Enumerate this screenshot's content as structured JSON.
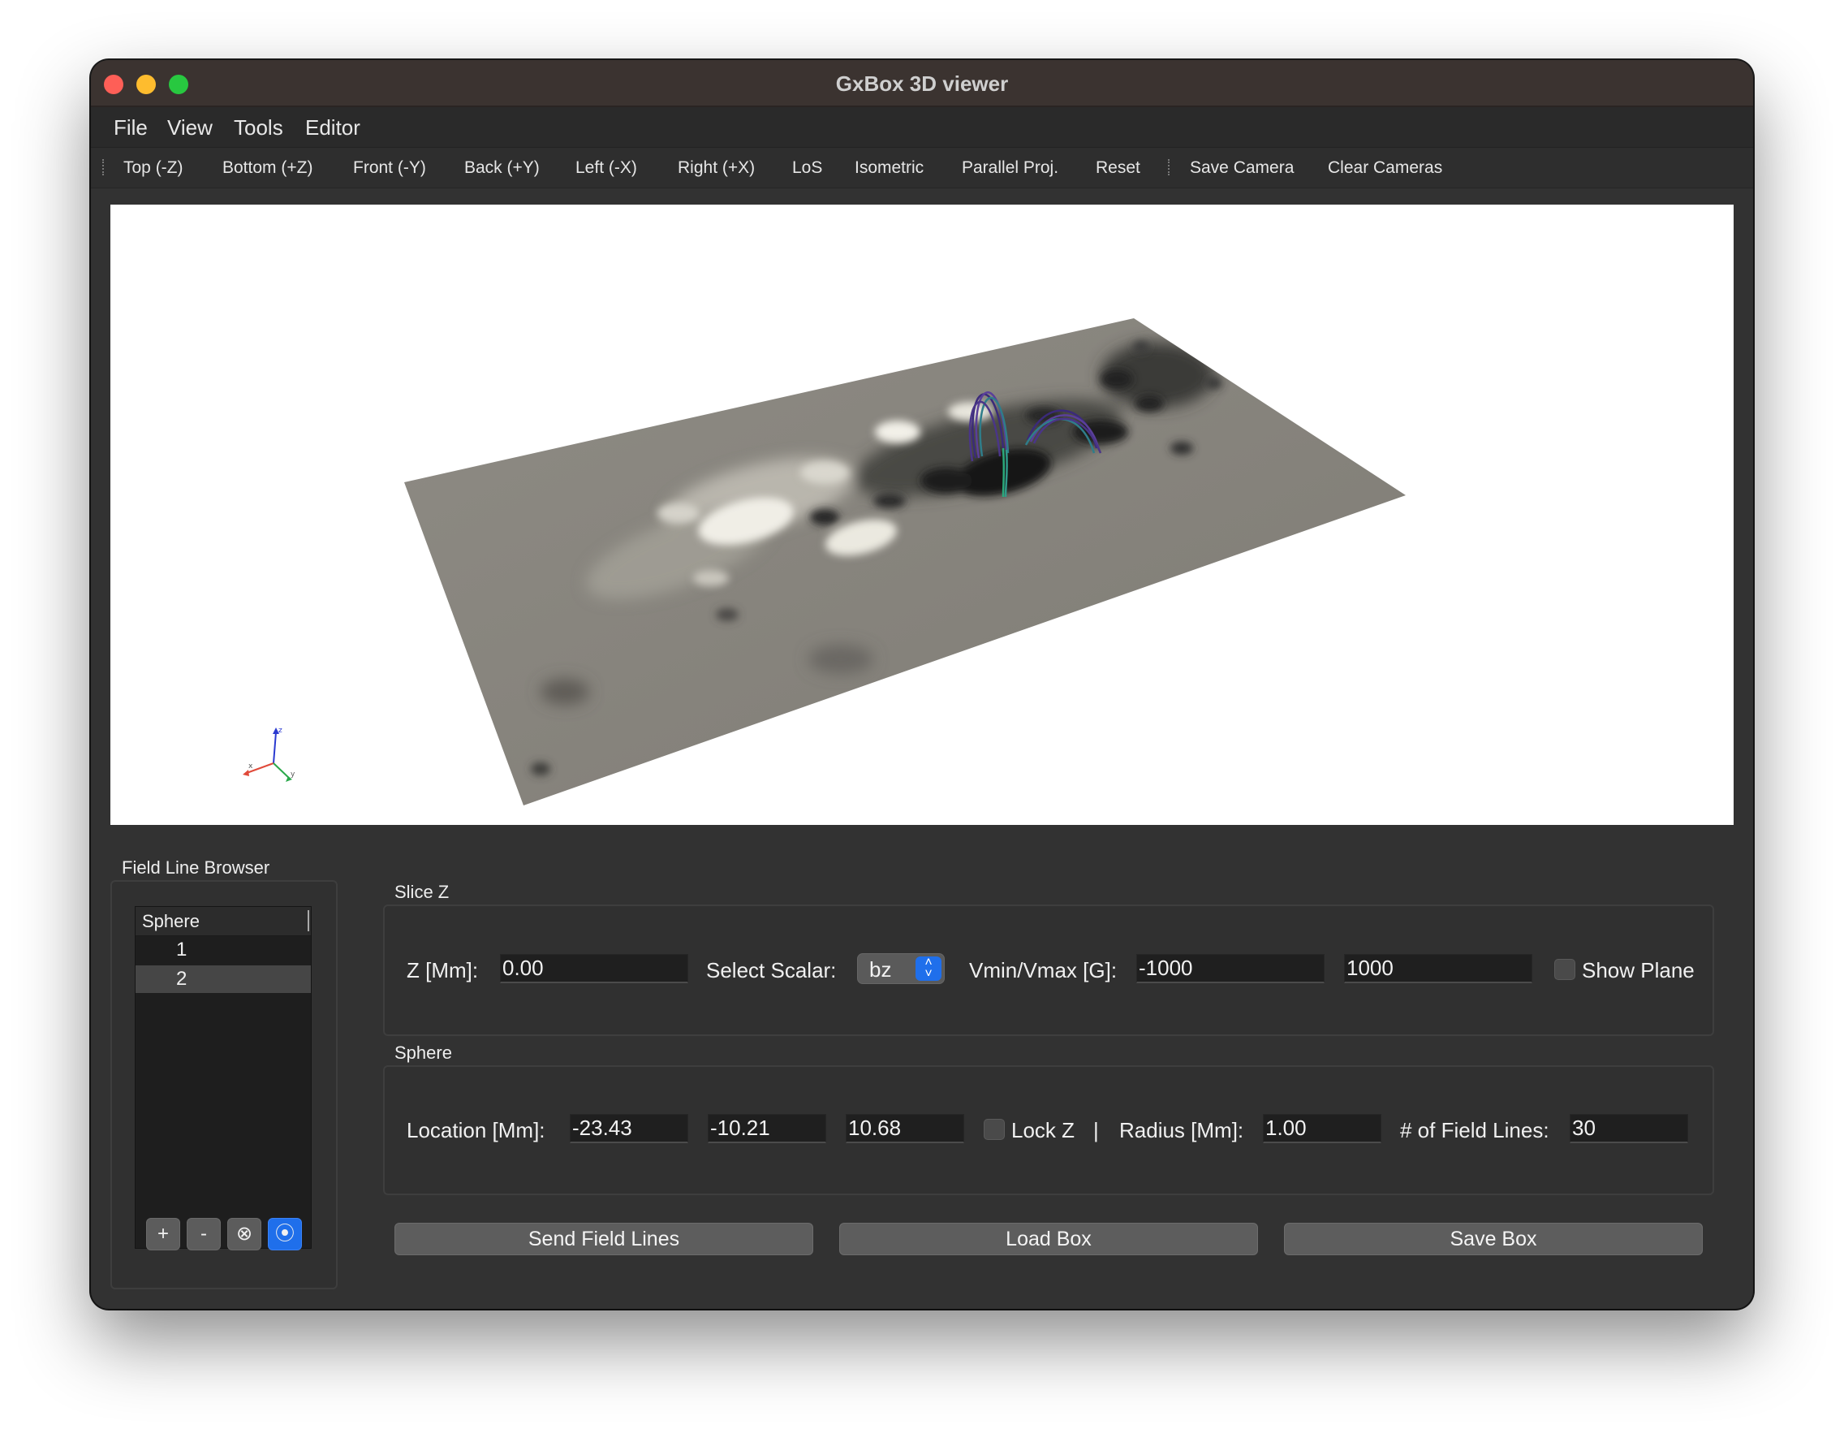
{
  "window": {
    "title": "GxBox 3D viewer"
  },
  "menu": [
    "File",
    "View",
    "Tools",
    "Editor"
  ],
  "toolbar": {
    "views": [
      "Top (-Z)",
      "Bottom (+Z)",
      "Front (-Y)",
      "Back (+Y)",
      "Left (-X)",
      "Right (+X)",
      "LoS",
      "Isometric",
      "Parallel Proj.",
      "Reset"
    ],
    "camera": [
      "Save Camera",
      "Clear Cameras"
    ]
  },
  "viewport": {
    "axes": {
      "x_label": "x",
      "y_label": "y",
      "z_label": "z",
      "x_color": "#e04a3a",
      "y_color": "#2aa84a",
      "z_color": "#2a3ad0"
    },
    "plane_colors": {
      "base": "#8a8780",
      "positive": "#f2f0e8",
      "negative": "#141414"
    },
    "field_line_colors": [
      "#3b2a7a",
      "#5a3f9a",
      "#2f7d8a",
      "#2aa87a"
    ]
  },
  "field_line_browser": {
    "title": "Field Line Browser",
    "column_header": "Sphere",
    "rows": [
      "1",
      "2"
    ],
    "selected_index": 1,
    "buttons": {
      "add": "+",
      "remove": "-",
      "clear": "⊗",
      "target": "⦿"
    }
  },
  "slice_z": {
    "title": "Slice Z",
    "z_label": "Z [Mm]:",
    "z_value": "0.00",
    "scalar_label": "Select Scalar:",
    "scalar_value": "bz",
    "vrange_label": "Vmin/Vmax [G]:",
    "vmin": "-1000",
    "vmax": "1000",
    "show_plane_label": "Show Plane",
    "show_plane_checked": false
  },
  "sphere": {
    "title": "Sphere",
    "location_label": "Location [Mm]:",
    "loc_x": "-23.43",
    "loc_y": "-10.21",
    "loc_z": "10.68",
    "lock_z_label": "Lock Z",
    "lock_z_checked": false,
    "separator": "|",
    "radius_label": "Radius [Mm]:",
    "radius_value": "1.00",
    "n_lines_label": "# of Field Lines:",
    "n_lines_value": "30"
  },
  "actions": {
    "send": "Send Field Lines",
    "load": "Load Box",
    "save": "Save Box"
  }
}
